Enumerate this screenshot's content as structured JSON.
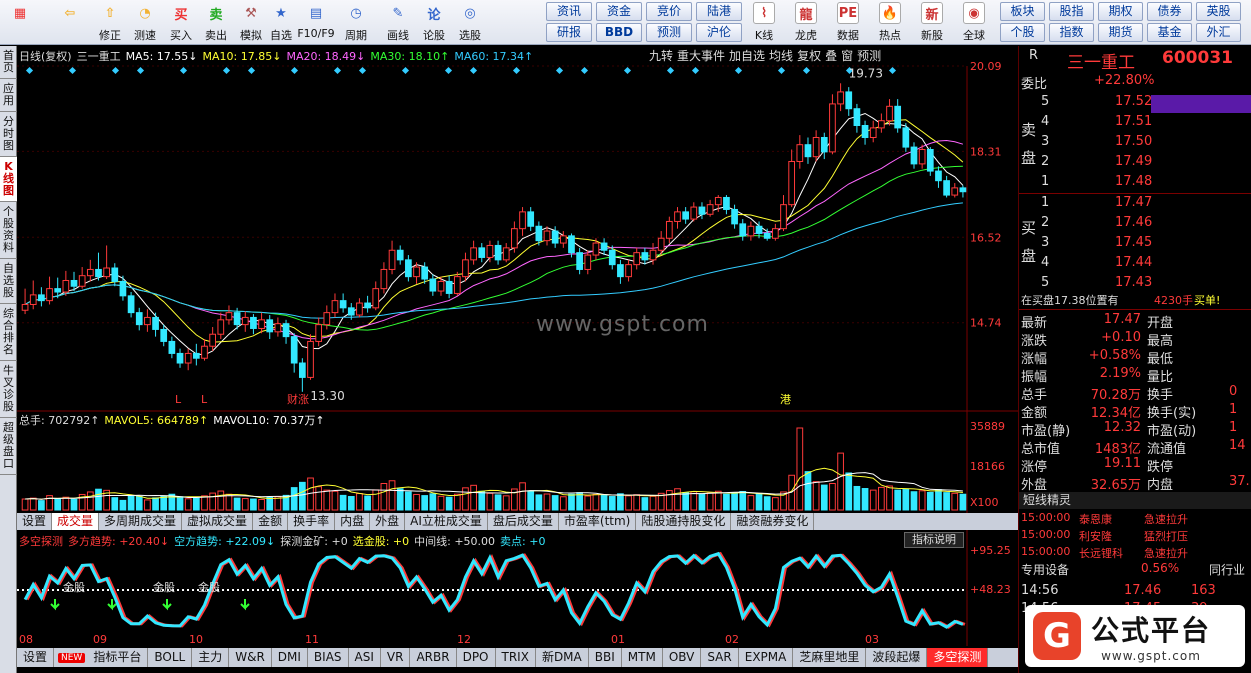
{
  "toolbar": {
    "buttons": [
      {
        "label": "",
        "icon": "grid-icon",
        "color": "#e33"
      },
      {
        "label": "",
        "icon": "back-arrow-icon",
        "color": "#f2b233"
      },
      {
        "label": "修正",
        "icon": "up-arrow-icon",
        "color": "#f2b233"
      },
      {
        "label": "测速",
        "icon": "speed-icon",
        "color": "#f2b233"
      },
      {
        "label": "买入",
        "icon": "buy-icon",
        "color": "#e33"
      },
      {
        "label": "卖出",
        "icon": "sell-icon",
        "color": "#2a2"
      },
      {
        "label": "模拟",
        "icon": "hammer-icon",
        "color": "#a55"
      },
      {
        "label": "自选",
        "icon": "star-icon",
        "color": "#36c"
      },
      {
        "label": "F10/F9",
        "icon": "f10-icon",
        "color": "#36c"
      },
      {
        "label": "周期",
        "icon": "clock-icon",
        "color": "#36c"
      },
      {
        "label": "画线",
        "icon": "pencil-icon",
        "color": "#36c"
      },
      {
        "label": "论股",
        "icon": "discuss-icon",
        "color": "#36c"
      },
      {
        "label": "选股",
        "icon": "select-stock-icon",
        "color": "#36c"
      }
    ],
    "quick": [
      [
        "资讯",
        "研报"
      ],
      [
        "资金",
        "BBD"
      ],
      [
        "竞价",
        "预测"
      ],
      [
        "陆港",
        "沪伦"
      ]
    ],
    "right_buttons": [
      {
        "label": "K线",
        "icon": "kline-icon"
      },
      {
        "label": "龙虎",
        "icon": "dragon-tiger-icon"
      },
      {
        "label": "数据",
        "icon": "pe-icon"
      },
      {
        "label": "热点",
        "icon": "hot-icon"
      },
      {
        "label": "新股",
        "icon": "new-stock-icon"
      },
      {
        "label": "全球",
        "icon": "globe-icon"
      }
    ],
    "quick2": [
      [
        "板块",
        "个股"
      ],
      [
        "股指",
        "指数"
      ],
      [
        "期权",
        "期货"
      ],
      [
        "债券",
        "基金"
      ],
      [
        "英股",
        "外汇"
      ]
    ]
  },
  "sidebar": [
    "首页",
    "应用",
    "分时图",
    "K线图",
    "个股资料",
    "自选股",
    "综合排名",
    "牛叉诊股",
    "超级盘口"
  ],
  "kline": {
    "header": [
      {
        "text": "日线(复权)",
        "color": "#dddddd"
      },
      {
        "text": "三一重工",
        "color": "#dddddd"
      },
      {
        "text": "MA5: 17.55↓",
        "color": "#ffffff"
      },
      {
        "text": "MA10: 17.85↓",
        "color": "#ffff33"
      },
      {
        "text": "MA20: 18.49↓",
        "color": "#ff66ff"
      },
      {
        "text": "MA30: 18.10↑",
        "color": "#33ff33"
      },
      {
        "text": "MA60: 17.34↑",
        "color": "#33ccff"
      }
    ],
    "toolbar": [
      "九转",
      "重大事件",
      "加自选",
      "均线",
      "复权",
      "叠",
      "窗",
      "预测"
    ],
    "price_ticks": [
      "20.09",
      "18.31",
      "16.52",
      "14.74"
    ],
    "max_label": "19.73",
    "min_label": "13.30",
    "markers": [
      {
        "text": "L",
        "color": "#ff3a3a"
      },
      {
        "text": "L",
        "color": "#ff3a3a"
      },
      {
        "text": "财",
        "color": "#ff3a3a"
      },
      {
        "text": "涨",
        "color": "#ff3a3a"
      },
      {
        "text": "港",
        "color": "#ffff33"
      }
    ],
    "watermark": "www.gspt.com"
  },
  "volume": {
    "header": [
      {
        "text": "总手: 702792↑",
        "color": "#dddddd"
      },
      {
        "text": "MAVOL5: 664789↑",
        "color": "#ffff33"
      },
      {
        "text": "MAVOL10: 70.37万↑",
        "color": "#ffffff"
      }
    ],
    "ticks": [
      "35889",
      "18166",
      "X100"
    ]
  },
  "ind_tabs": [
    "设置",
    "成交量",
    "多周期成交量",
    "虚拟成交量",
    "金额",
    "换手率",
    "内盘",
    "外盘",
    "AI立桩成交量",
    "盘后成交量",
    "市盈率(ttm)",
    "陆股通持股变化",
    "融资融券变化"
  ],
  "indicator": {
    "header": [
      {
        "text": "多空探测",
        "color": "#ff3a3a"
      },
      {
        "text": "多方趋势: +20.40↓",
        "color": "#ff3a3a"
      },
      {
        "text": "空方趋势: +22.09↓",
        "color": "#33e8ff"
      },
      {
        "text": "探测金矿: +0",
        "color": "#dddddd"
      },
      {
        "text": "选金股: +0",
        "color": "#ffff33"
      },
      {
        "text": "中间线: +50.00",
        "color": "#dddddd"
      },
      {
        "text": "卖点: +0",
        "color": "#33e8ff"
      }
    ],
    "explain": "指标说明",
    "ticks": [
      "+95.25",
      "+48.23"
    ],
    "gold_labels": [
      "金股",
      "金股",
      "金股"
    ],
    "months": [
      "08",
      "09",
      "10",
      "11",
      "12",
      "01",
      "02",
      "03"
    ]
  },
  "bottom_tabs": [
    "设置",
    "NEW",
    "指标平台",
    "BOLL",
    "主力",
    "W&R",
    "DMI",
    "BIAS",
    "ASI",
    "VR",
    "ARBR",
    "DPO",
    "TRIX",
    "新DMA",
    "BBI",
    "MTM",
    "OBV",
    "SAR",
    "EXPMA",
    "芝麻里地里",
    "波段起爆",
    "多空探测"
  ],
  "quote": {
    "code_prefix": "R",
    "name": "三一重工",
    "code": "600031",
    "weibi_label": "委比",
    "weibi": "+22.80%",
    "sell_label": "卖盘",
    "buy_label": "买盘",
    "asks": [
      [
        "5",
        "17.52",
        ""
      ],
      [
        "4",
        "17.51",
        ""
      ],
      [
        "3",
        "17.50",
        ""
      ],
      [
        "2",
        "17.49",
        ""
      ],
      [
        "1",
        "17.48",
        ""
      ]
    ],
    "bids": [
      [
        "1",
        "17.47",
        ""
      ],
      [
        "2",
        "17.46",
        ""
      ],
      [
        "3",
        "17.45",
        ""
      ],
      [
        "4",
        "17.44",
        ""
      ],
      [
        "5",
        "17.43",
        ""
      ]
    ],
    "buy_note": "在买盘17.38位置有",
    "buy_note_vol": "4230手",
    "buy_note_end": "买单!",
    "stats": [
      [
        "最新",
        "17.47",
        "开盘",
        ""
      ],
      [
        "涨跌",
        "+0.10",
        "最高",
        ""
      ],
      [
        "涨幅",
        "+0.58%",
        "最低",
        ""
      ],
      [
        "振幅",
        "2.19%",
        "量比",
        ""
      ],
      [
        "总手",
        "70.28万",
        "换手",
        "0"
      ],
      [
        "金额",
        "12.34亿",
        "换手(实)",
        "1"
      ],
      [
        "市盈(静)",
        "12.32",
        "市盈(动)",
        "1"
      ],
      [
        "总市值",
        "1483亿",
        "流通值",
        "14"
      ],
      [
        "涨停",
        "19.11",
        "跌停",
        ""
      ],
      [
        "外盘",
        "32.65万",
        "内盘",
        "37."
      ]
    ],
    "short_title": "短线精灵",
    "shorts": [
      [
        "15:00:00",
        "泰恩康",
        "急速拉升"
      ],
      [
        "15:00:00",
        "利安隆",
        "猛烈打压"
      ],
      [
        "15:00:00",
        "长远锂科",
        "急速拉升"
      ]
    ],
    "device_label": "专用设备",
    "device_pct": "0.56%",
    "peer_label": "同行业",
    "ticks": [
      [
        "14:56",
        "17.46",
        "163"
      ],
      [
        "14:56",
        "17.45",
        "39"
      ]
    ],
    "logo_text": "公式平台",
    "logo_url": "www.gspt.com"
  },
  "chart_data": {
    "type": "candlestick",
    "price_range": [
      12.9,
      20.09
    ],
    "candles": [
      [
        15.0,
        15.12,
        15.45,
        14.92
      ],
      [
        15.12,
        15.32,
        15.62,
        15.02
      ],
      [
        15.32,
        15.2,
        15.48,
        15.08
      ],
      [
        15.2,
        15.45,
        15.7,
        15.12
      ],
      [
        15.45,
        15.38,
        15.68,
        15.25
      ],
      [
        15.38,
        15.62,
        15.82,
        15.3
      ],
      [
        15.62,
        15.5,
        15.8,
        15.4
      ],
      [
        15.5,
        15.72,
        15.9,
        15.45
      ],
      [
        15.72,
        15.85,
        16.05,
        15.6
      ],
      [
        15.85,
        15.7,
        16.2,
        15.62
      ],
      [
        15.7,
        15.88,
        16.35,
        15.65
      ],
      [
        15.88,
        15.6,
        15.98,
        15.5
      ],
      [
        15.6,
        15.3,
        15.72,
        15.2
      ],
      [
        15.3,
        14.95,
        15.38,
        14.85
      ],
      [
        14.95,
        14.7,
        15.05,
        14.58
      ],
      [
        14.7,
        14.85,
        15.02,
        14.55
      ],
      [
        14.85,
        14.6,
        14.95,
        14.45
      ],
      [
        14.6,
        14.35,
        14.7,
        14.25
      ],
      [
        14.35,
        14.1,
        14.45,
        14.0
      ],
      [
        14.1,
        13.9,
        14.2,
        13.8
      ],
      [
        13.9,
        14.1,
        14.2,
        13.75
      ],
      [
        14.1,
        14.0,
        14.3,
        13.85
      ],
      [
        14.0,
        14.25,
        14.4,
        13.95
      ],
      [
        14.25,
        14.5,
        14.65,
        14.15
      ],
      [
        14.5,
        14.8,
        14.95,
        14.4
      ],
      [
        14.8,
        14.95,
        15.1,
        14.7
      ],
      [
        14.95,
        14.7,
        15.05,
        14.6
      ],
      [
        14.7,
        14.85,
        14.98,
        14.55
      ],
      [
        14.85,
        14.62,
        14.92,
        14.5
      ],
      [
        14.62,
        14.8,
        14.95,
        14.52
      ],
      [
        14.8,
        14.55,
        14.9,
        14.4
      ],
      [
        14.55,
        14.72,
        14.85,
        14.45
      ],
      [
        14.72,
        14.45,
        14.8,
        14.3
      ],
      [
        14.45,
        13.9,
        14.52,
        13.7
      ],
      [
        13.9,
        13.6,
        14.0,
        13.3
      ],
      [
        13.6,
        14.35,
        14.5,
        13.55
      ],
      [
        14.35,
        14.7,
        14.85,
        14.25
      ],
      [
        14.7,
        14.95,
        15.1,
        14.6
      ],
      [
        14.95,
        15.2,
        15.35,
        14.85
      ],
      [
        15.2,
        15.05,
        15.35,
        14.95
      ],
      [
        15.05,
        14.9,
        15.15,
        14.8
      ],
      [
        14.9,
        15.15,
        15.25,
        14.85
      ],
      [
        15.15,
        15.05,
        15.3,
        14.95
      ],
      [
        15.05,
        15.45,
        15.6,
        15.0
      ],
      [
        15.45,
        15.85,
        16.0,
        15.35
      ],
      [
        15.85,
        16.25,
        16.45,
        15.75
      ],
      [
        16.25,
        16.05,
        16.35,
        15.95
      ],
      [
        16.05,
        15.7,
        16.15,
        15.6
      ],
      [
        15.7,
        15.9,
        16.0,
        15.55
      ],
      [
        15.9,
        15.65,
        16.0,
        15.55
      ],
      [
        15.65,
        15.4,
        15.75,
        15.3
      ],
      [
        15.4,
        15.6,
        15.7,
        15.3
      ],
      [
        15.6,
        15.35,
        15.72,
        15.25
      ],
      [
        15.35,
        15.7,
        15.8,
        15.3
      ],
      [
        15.7,
        16.05,
        16.2,
        15.6
      ],
      [
        16.05,
        16.3,
        16.45,
        15.95
      ],
      [
        16.3,
        16.1,
        16.4,
        16.0
      ],
      [
        16.1,
        16.35,
        16.45,
        16.0
      ],
      [
        16.35,
        16.05,
        16.45,
        15.95
      ],
      [
        16.05,
        16.3,
        16.4,
        16.0
      ],
      [
        16.3,
        16.7,
        16.85,
        16.2
      ],
      [
        16.7,
        17.05,
        17.15,
        16.55
      ],
      [
        17.05,
        16.75,
        17.15,
        16.65
      ],
      [
        16.75,
        16.45,
        16.85,
        16.35
      ],
      [
        16.45,
        16.65,
        16.75,
        16.35
      ],
      [
        16.65,
        16.4,
        16.75,
        16.3
      ],
      [
        16.4,
        16.55,
        16.65,
        16.3
      ],
      [
        16.55,
        16.2,
        16.6,
        16.1
      ],
      [
        16.2,
        15.85,
        16.3,
        15.75
      ],
      [
        15.85,
        16.15,
        16.25,
        15.75
      ],
      [
        16.15,
        16.4,
        16.5,
        16.05
      ],
      [
        16.4,
        16.25,
        16.5,
        16.15
      ],
      [
        16.25,
        15.95,
        16.35,
        15.85
      ],
      [
        15.95,
        15.7,
        16.05,
        15.55
      ],
      [
        15.7,
        15.95,
        16.05,
        15.6
      ],
      [
        15.95,
        16.2,
        16.3,
        15.85
      ],
      [
        16.2,
        16.05,
        16.3,
        15.95
      ],
      [
        16.05,
        16.25,
        16.4,
        15.95
      ],
      [
        16.25,
        16.5,
        16.65,
        16.15
      ],
      [
        16.5,
        16.85,
        16.95,
        16.4
      ],
      [
        16.85,
        17.05,
        17.15,
        16.7
      ],
      [
        17.05,
        16.9,
        17.15,
        16.8
      ],
      [
        16.9,
        17.15,
        17.25,
        16.85
      ],
      [
        17.15,
        17.0,
        17.25,
        16.9
      ],
      [
        17.0,
        17.2,
        17.3,
        16.95
      ],
      [
        17.2,
        17.35,
        17.4,
        17.05
      ],
      [
        17.35,
        17.1,
        17.4,
        17.0
      ],
      [
        17.1,
        16.8,
        17.2,
        16.7
      ],
      [
        16.8,
        16.55,
        16.9,
        16.45
      ],
      [
        16.55,
        16.75,
        16.85,
        16.45
      ],
      [
        16.75,
        16.6,
        16.85,
        16.5
      ],
      [
        16.6,
        16.5,
        16.7,
        16.45
      ],
      [
        16.5,
        16.7,
        16.8,
        16.45
      ],
      [
        16.7,
        17.2,
        17.4,
        16.65
      ],
      [
        17.2,
        18.1,
        18.35,
        17.15
      ],
      [
        18.1,
        18.45,
        18.65,
        17.95
      ],
      [
        18.45,
        18.2,
        18.6,
        18.05
      ],
      [
        18.2,
        18.6,
        18.75,
        18.1
      ],
      [
        18.6,
        18.3,
        18.7,
        18.15
      ],
      [
        18.3,
        19.3,
        19.5,
        18.25
      ],
      [
        19.3,
        19.55,
        19.73,
        19.15
      ],
      [
        19.55,
        19.2,
        19.65,
        19.05
      ],
      [
        19.2,
        18.85,
        19.3,
        18.7
      ],
      [
        18.85,
        18.6,
        18.95,
        18.45
      ],
      [
        18.6,
        18.8,
        18.95,
        18.5
      ],
      [
        18.8,
        18.95,
        19.1,
        18.7
      ],
      [
        18.95,
        19.25,
        19.4,
        18.85
      ],
      [
        19.25,
        18.8,
        19.4,
        18.7
      ],
      [
        18.8,
        18.4,
        18.9,
        18.3
      ],
      [
        18.4,
        18.05,
        18.5,
        17.95
      ],
      [
        18.05,
        18.35,
        18.45,
        17.95
      ],
      [
        18.35,
        17.9,
        18.4,
        17.8
      ],
      [
        17.9,
        17.7,
        18.0,
        17.55
      ],
      [
        17.7,
        17.4,
        17.8,
        17.35
      ],
      [
        17.4,
        17.55,
        17.65,
        17.35
      ],
      [
        17.55,
        17.47,
        17.6,
        17.35
      ]
    ],
    "ma_series": [
      {
        "name": "MA5",
        "color": "#ffffff"
      },
      {
        "name": "MA10",
        "color": "#ffff33"
      },
      {
        "name": "MA20",
        "color": "#ff66ff"
      },
      {
        "name": "MA30",
        "color": "#33ff33"
      },
      {
        "name": "MA60",
        "color": "#33ccff"
      }
    ],
    "volume_max": 35889,
    "volume": [
      4800,
      5200,
      4100,
      6300,
      5000,
      5600,
      4700,
      6800,
      7900,
      9100,
      8600,
      5400,
      4200,
      6000,
      5900,
      4400,
      5300,
      6100,
      6900,
      5800,
      4900,
      5100,
      6200,
      7400,
      8300,
      6900,
      5200,
      5000,
      4800,
      4600,
      5500,
      5800,
      6400,
      9800,
      12100,
      14000,
      10200,
      8700,
      8200,
      6400,
      5900,
      7200,
      6100,
      8800,
      11600,
      12800,
      9300,
      7900,
      6800,
      6300,
      7100,
      6000,
      5600,
      6900,
      9700,
      10800,
      8200,
      7300,
      6600,
      6200,
      9200,
      11900,
      8100,
      6600,
      7000,
      6300,
      5800,
      6900,
      7600,
      6100,
      6800,
      6500,
      5900,
      7100,
      6200,
      6700,
      5400,
      6000,
      7300,
      8500,
      9300,
      7600,
      8000,
      6800,
      7400,
      8200,
      6900,
      7600,
      8100,
      6300,
      7000,
      5800,
      5400,
      7900,
      15200,
      35889,
      16800,
      12400,
      10900,
      11600,
      24900,
      16200,
      10300,
      9400,
      8700,
      9900,
      10500,
      8700,
      9100,
      8000,
      8400,
      7700,
      8900,
      7600,
      7300,
      6900
    ]
  }
}
